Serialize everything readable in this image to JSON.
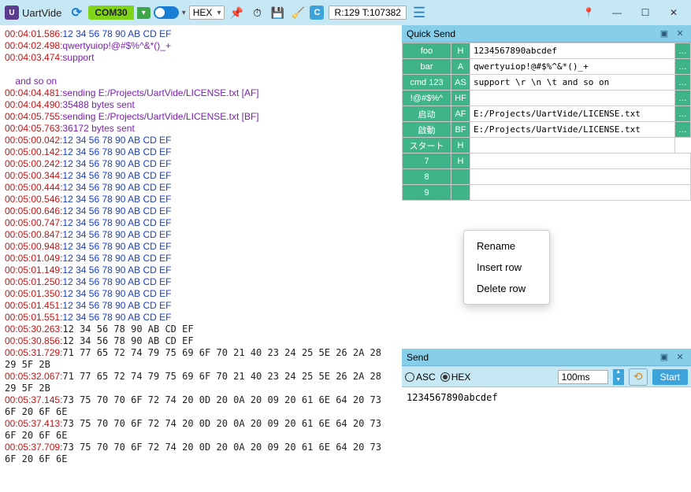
{
  "title": "UartVide",
  "port": "COM30",
  "display_mode": "HEX",
  "stats": "R:129 T:107382",
  "quick_send": {
    "title": "Quick Send",
    "rows": [
      {
        "name": "foo",
        "fmt": "H",
        "data": "1234567890abcdef",
        "send": true
      },
      {
        "name": "bar",
        "fmt": "A",
        "data": "qwertyuiop!@#$%^&*()_+",
        "send": true
      },
      {
        "name": "cmd 123",
        "fmt": "AS",
        "data": "support \\r \\n \\t and so on",
        "send": true
      },
      {
        "name": "!@#$%^",
        "fmt": "HF",
        "data": "",
        "send": true
      },
      {
        "name": "启动",
        "fmt": "AF",
        "data": "E:/Projects/UartVide/LICENSE.txt",
        "send": true
      },
      {
        "name": "啟動",
        "fmt": "BF",
        "data": "E:/Projects/UartVide/LICENSE.txt",
        "send": true
      },
      {
        "name": "スタート",
        "fmt": "H",
        "data": "",
        "send": false
      },
      {
        "name": "7",
        "fmt": "H",
        "data": "",
        "send": false
      },
      {
        "name": "8",
        "fmt": "",
        "data": "",
        "send": false
      },
      {
        "name": "9",
        "fmt": "",
        "data": "",
        "send": false
      }
    ]
  },
  "context_menu": [
    "Rename",
    "Insert row",
    "Delete row"
  ],
  "send": {
    "title": "Send",
    "mode_asc": "ASC",
    "mode_hex": "HEX",
    "interval": "100ms",
    "start": "Start",
    "text": "1234567890abcdef"
  },
  "log": [
    {
      "ts": "00:04:01.586:",
      "cls": "hex",
      "txt": "12 34 56 78 90 AB CD EF"
    },
    {
      "ts": "00:04:02.498:",
      "cls": "txt",
      "txt": "qwertyuiop!@#$%^&*()_+"
    },
    {
      "ts": "00:04:03.474:",
      "cls": "txt",
      "txt": "support"
    },
    {
      "ts": "",
      "cls": "txt",
      "txt": ""
    },
    {
      "ts": "",
      "cls": "txt",
      "txt": "    and so on"
    },
    {
      "ts": "00:04:04.481:",
      "cls": "txt",
      "txt": "sending E:/Projects/UartVide/LICENSE.txt [AF]"
    },
    {
      "ts": "00:04:04.490:",
      "cls": "txt",
      "txt": "35488 bytes sent"
    },
    {
      "ts": "00:04:05.755:",
      "cls": "txt",
      "txt": "sending E:/Projects/UartVide/LICENSE.txt [BF]"
    },
    {
      "ts": "00:04:05.763:",
      "cls": "txt",
      "txt": "36172 bytes sent"
    },
    {
      "ts": "00:05:00.042:",
      "cls": "hex",
      "txt": "12 34 56 78 90 AB CD EF"
    },
    {
      "ts": "00:05:00.142:",
      "cls": "hex",
      "txt": "12 34 56 78 90 AB CD EF"
    },
    {
      "ts": "00:05:00.242:",
      "cls": "hex",
      "txt": "12 34 56 78 90 AB CD EF"
    },
    {
      "ts": "00:05:00.344:",
      "cls": "hex",
      "txt": "12 34 56 78 90 AB CD EF"
    },
    {
      "ts": "00:05:00.444:",
      "cls": "hex",
      "txt": "12 34 56 78 90 AB CD EF"
    },
    {
      "ts": "00:05:00.546:",
      "cls": "hex",
      "txt": "12 34 56 78 90 AB CD EF"
    },
    {
      "ts": "00:05:00.646:",
      "cls": "hex",
      "txt": "12 34 56 78 90 AB CD EF"
    },
    {
      "ts": "00:05:00.747:",
      "cls": "hex",
      "txt": "12 34 56 78 90 AB CD EF"
    },
    {
      "ts": "00:05:00.847:",
      "cls": "hex",
      "txt": "12 34 56 78 90 AB CD EF"
    },
    {
      "ts": "00:05:00.948:",
      "cls": "hex",
      "txt": "12 34 56 78 90 AB CD EF"
    },
    {
      "ts": "00:05:01.049:",
      "cls": "hex",
      "txt": "12 34 56 78 90 AB CD EF"
    },
    {
      "ts": "00:05:01.149:",
      "cls": "hex",
      "txt": "12 34 56 78 90 AB CD EF"
    },
    {
      "ts": "00:05:01.250:",
      "cls": "hex",
      "txt": "12 34 56 78 90 AB CD EF"
    },
    {
      "ts": "00:05:01.350:",
      "cls": "hex",
      "txt": "12 34 56 78 90 AB CD EF"
    },
    {
      "ts": "00:05:01.451:",
      "cls": "hex",
      "txt": "12 34 56 78 90 AB CD EF"
    },
    {
      "ts": "00:05:01.551:",
      "cls": "hex",
      "txt": "12 34 56 78 90 AB CD EF"
    },
    {
      "ts": "00:05:30.263:",
      "cls": "",
      "txt": "12 34 56 78 90 AB CD EF"
    },
    {
      "ts": "00:05:30.856:",
      "cls": "",
      "txt": "12 34 56 78 90 AB CD EF"
    },
    {
      "ts": "00:05:31.729:",
      "cls": "",
      "txt": "71 77 65 72 74 79 75 69 6F 70 21 40 23 24 25 5E 26 2A 28"
    },
    {
      "ts": "",
      "cls": "",
      "txt": "29 5F 2B"
    },
    {
      "ts": "00:05:32.067:",
      "cls": "",
      "txt": "71 77 65 72 74 79 75 69 6F 70 21 40 23 24 25 5E 26 2A 28"
    },
    {
      "ts": "",
      "cls": "",
      "txt": "29 5F 2B"
    },
    {
      "ts": "00:05:37.145:",
      "cls": "",
      "txt": "73 75 70 70 6F 72 74 20 0D 20 0A 20 09 20 61 6E 64 20 73"
    },
    {
      "ts": "",
      "cls": "",
      "txt": "6F 20 6F 6E"
    },
    {
      "ts": "00:05:37.413:",
      "cls": "",
      "txt": "73 75 70 70 6F 72 74 20 0D 20 0A 20 09 20 61 6E 64 20 73"
    },
    {
      "ts": "",
      "cls": "",
      "txt": "6F 20 6F 6E"
    },
    {
      "ts": "00:05:37.709:",
      "cls": "",
      "txt": "73 75 70 70 6F 72 74 20 0D 20 0A 20 09 20 61 6E 64 20 73"
    },
    {
      "ts": "",
      "cls": "",
      "txt": "6F 20 6F 6E"
    }
  ]
}
